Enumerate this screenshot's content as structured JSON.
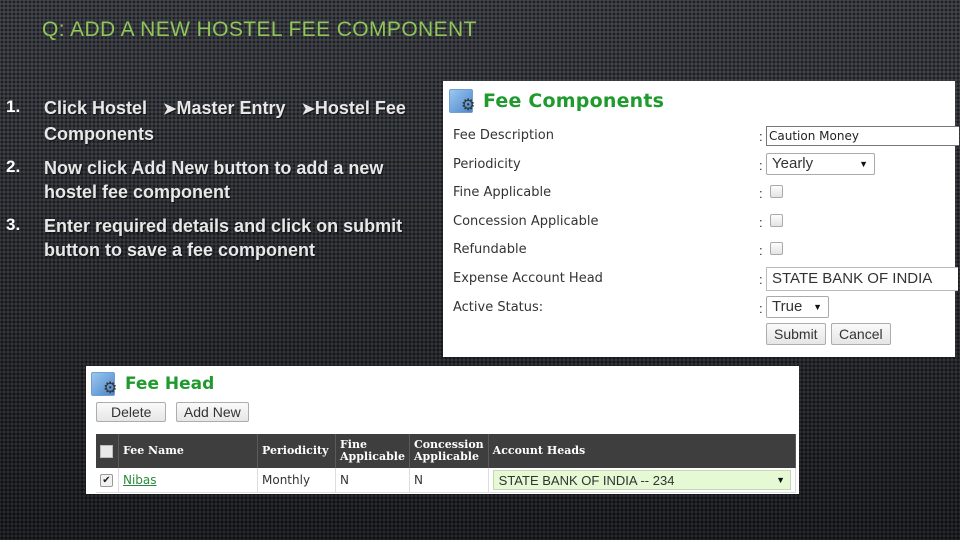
{
  "slide": {
    "title": "Q: ADD A NEW HOSTEL FEE COMPONENT",
    "arrow_glyph": "➤",
    "steps": [
      {
        "number": "1.",
        "parts": [
          "Click Hostel",
          "Master Entry",
          "Hostel Fee Components"
        ]
      },
      {
        "number": "2.",
        "text": "Now click Add New button to add a new hostel fee component"
      },
      {
        "number": "3.",
        "text": "Enter required details and click on submit button to save a fee component"
      }
    ]
  },
  "fee_components": {
    "title": "Fee Components",
    "icon": "settings-app-icon",
    "fields": {
      "fee_description": {
        "label": "Fee Description",
        "value": "Caution Money"
      },
      "periodicity": {
        "label": "Periodicity",
        "value": "Yearly"
      },
      "fine_applicable": {
        "label": "Fine Applicable",
        "checked": false
      },
      "concession_applicable": {
        "label": "Concession Applicable",
        "checked": false
      },
      "refundable": {
        "label": "Refundable",
        "checked": false
      },
      "expense_account_head": {
        "label": "Expense Account Head",
        "value": "STATE BANK OF INDIA"
      },
      "active_status": {
        "label": "Active Status:",
        "value": "True"
      }
    },
    "colon": ":",
    "submit_label": "Submit",
    "cancel_label": "Cancel"
  },
  "fee_head": {
    "title": "Fee Head",
    "icon": "settings-app-icon",
    "delete_label": "Delete",
    "add_new_label": "Add New",
    "columns": [
      "Fee Name",
      "Periodicity",
      "Fine Applicable",
      "Concession Applicable",
      "Account Heads"
    ],
    "rows": [
      {
        "checked": true,
        "fee_name": "Nibas",
        "periodicity": "Monthly",
        "fine_applicable": "N",
        "concession_applicable": "N",
        "account_head": "STATE BANK OF INDIA -- 234"
      }
    ]
  },
  "colors": {
    "title_green": "#8fc65a",
    "panel_title_green": "#1f9a2d",
    "header_dark": "#3e3e3e",
    "account_select_bg": "#e4f9d4"
  }
}
